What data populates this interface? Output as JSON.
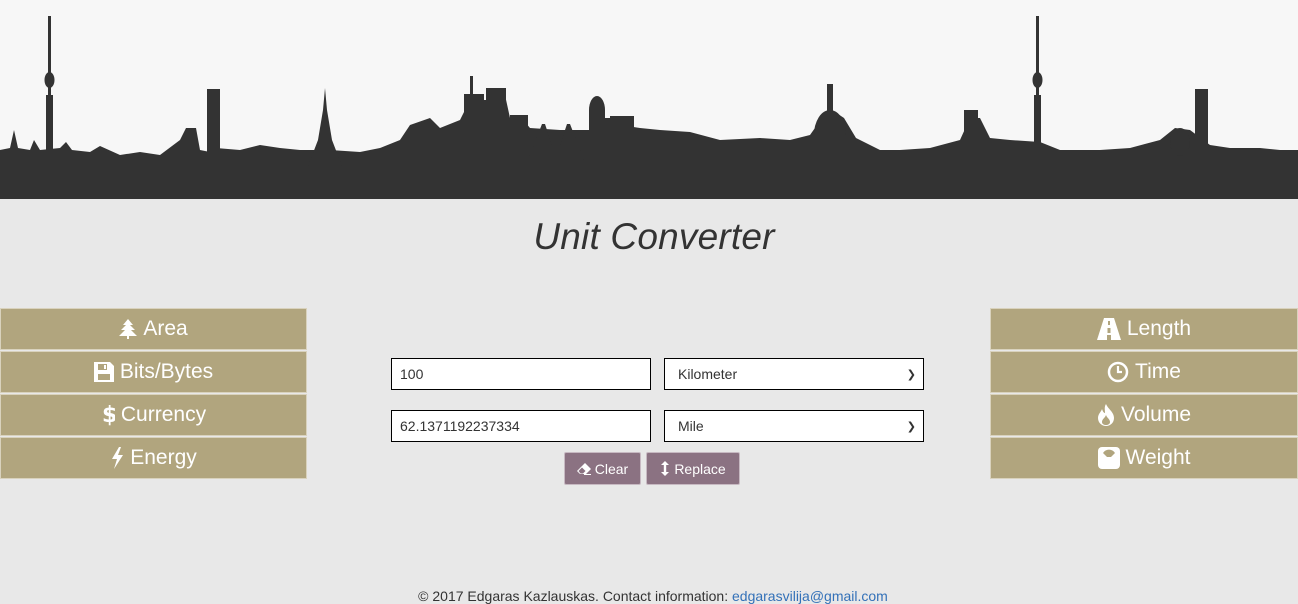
{
  "header": {
    "title": "Unit Converter"
  },
  "left_nav": [
    {
      "label": "Area",
      "icon": "tree-icon"
    },
    {
      "label": "Bits/Bytes",
      "icon": "floppy-disk-icon"
    },
    {
      "label": "Currency",
      "icon": "dollar-icon"
    },
    {
      "label": "Energy",
      "icon": "lightning-icon"
    }
  ],
  "right_nav": [
    {
      "label": "Length",
      "icon": "road-icon"
    },
    {
      "label": "Time",
      "icon": "clock-icon"
    },
    {
      "label": "Volume",
      "icon": "fire-icon"
    },
    {
      "label": "Weight",
      "icon": "scale-icon"
    }
  ],
  "converter": {
    "input_value": "100",
    "input_unit": "Kilometer",
    "output_value": "62.1371192237334",
    "output_unit": "Mile",
    "clear_label": "Clear",
    "replace_label": "Replace"
  },
  "footer": {
    "text": "© 2017 Edgaras Kazlauskas. Contact information: ",
    "email": "edgarasvilija@gmail.com"
  },
  "colors": {
    "nav_button": "#b1a57e",
    "action_button": "#8b7282",
    "page_background": "#e8e8e8",
    "skyline": "#333333",
    "link": "#3371b8"
  }
}
